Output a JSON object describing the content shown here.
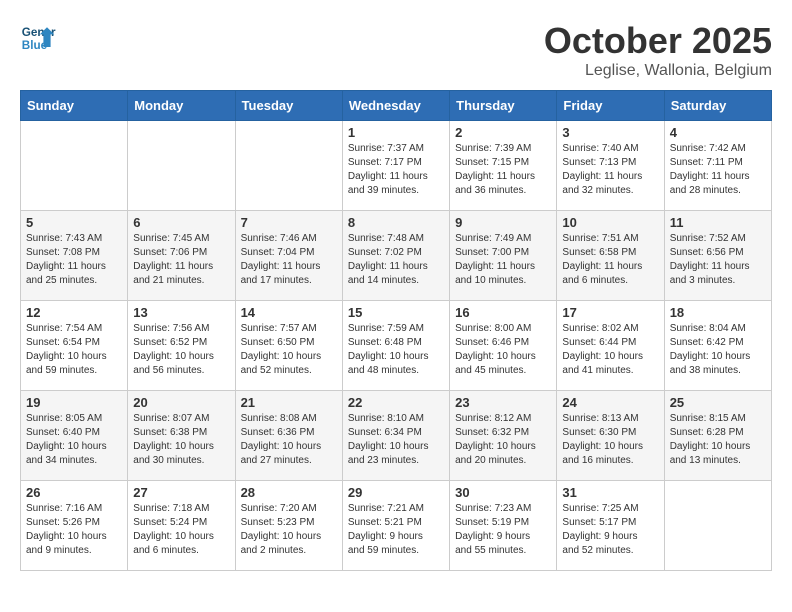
{
  "header": {
    "logo_line1": "General",
    "logo_line2": "Blue",
    "title": "October 2025",
    "subtitle": "Leglise, Wallonia, Belgium"
  },
  "days_of_week": [
    "Sunday",
    "Monday",
    "Tuesday",
    "Wednesday",
    "Thursday",
    "Friday",
    "Saturday"
  ],
  "weeks": [
    [
      {
        "num": "",
        "info": ""
      },
      {
        "num": "",
        "info": ""
      },
      {
        "num": "",
        "info": ""
      },
      {
        "num": "1",
        "info": "Sunrise: 7:37 AM\nSunset: 7:17 PM\nDaylight: 11 hours\nand 39 minutes."
      },
      {
        "num": "2",
        "info": "Sunrise: 7:39 AM\nSunset: 7:15 PM\nDaylight: 11 hours\nand 36 minutes."
      },
      {
        "num": "3",
        "info": "Sunrise: 7:40 AM\nSunset: 7:13 PM\nDaylight: 11 hours\nand 32 minutes."
      },
      {
        "num": "4",
        "info": "Sunrise: 7:42 AM\nSunset: 7:11 PM\nDaylight: 11 hours\nand 28 minutes."
      }
    ],
    [
      {
        "num": "5",
        "info": "Sunrise: 7:43 AM\nSunset: 7:08 PM\nDaylight: 11 hours\nand 25 minutes."
      },
      {
        "num": "6",
        "info": "Sunrise: 7:45 AM\nSunset: 7:06 PM\nDaylight: 11 hours\nand 21 minutes."
      },
      {
        "num": "7",
        "info": "Sunrise: 7:46 AM\nSunset: 7:04 PM\nDaylight: 11 hours\nand 17 minutes."
      },
      {
        "num": "8",
        "info": "Sunrise: 7:48 AM\nSunset: 7:02 PM\nDaylight: 11 hours\nand 14 minutes."
      },
      {
        "num": "9",
        "info": "Sunrise: 7:49 AM\nSunset: 7:00 PM\nDaylight: 11 hours\nand 10 minutes."
      },
      {
        "num": "10",
        "info": "Sunrise: 7:51 AM\nSunset: 6:58 PM\nDaylight: 11 hours\nand 6 minutes."
      },
      {
        "num": "11",
        "info": "Sunrise: 7:52 AM\nSunset: 6:56 PM\nDaylight: 11 hours\nand 3 minutes."
      }
    ],
    [
      {
        "num": "12",
        "info": "Sunrise: 7:54 AM\nSunset: 6:54 PM\nDaylight: 10 hours\nand 59 minutes."
      },
      {
        "num": "13",
        "info": "Sunrise: 7:56 AM\nSunset: 6:52 PM\nDaylight: 10 hours\nand 56 minutes."
      },
      {
        "num": "14",
        "info": "Sunrise: 7:57 AM\nSunset: 6:50 PM\nDaylight: 10 hours\nand 52 minutes."
      },
      {
        "num": "15",
        "info": "Sunrise: 7:59 AM\nSunset: 6:48 PM\nDaylight: 10 hours\nand 48 minutes."
      },
      {
        "num": "16",
        "info": "Sunrise: 8:00 AM\nSunset: 6:46 PM\nDaylight: 10 hours\nand 45 minutes."
      },
      {
        "num": "17",
        "info": "Sunrise: 8:02 AM\nSunset: 6:44 PM\nDaylight: 10 hours\nand 41 minutes."
      },
      {
        "num": "18",
        "info": "Sunrise: 8:04 AM\nSunset: 6:42 PM\nDaylight: 10 hours\nand 38 minutes."
      }
    ],
    [
      {
        "num": "19",
        "info": "Sunrise: 8:05 AM\nSunset: 6:40 PM\nDaylight: 10 hours\nand 34 minutes."
      },
      {
        "num": "20",
        "info": "Sunrise: 8:07 AM\nSunset: 6:38 PM\nDaylight: 10 hours\nand 30 minutes."
      },
      {
        "num": "21",
        "info": "Sunrise: 8:08 AM\nSunset: 6:36 PM\nDaylight: 10 hours\nand 27 minutes."
      },
      {
        "num": "22",
        "info": "Sunrise: 8:10 AM\nSunset: 6:34 PM\nDaylight: 10 hours\nand 23 minutes."
      },
      {
        "num": "23",
        "info": "Sunrise: 8:12 AM\nSunset: 6:32 PM\nDaylight: 10 hours\nand 20 minutes."
      },
      {
        "num": "24",
        "info": "Sunrise: 8:13 AM\nSunset: 6:30 PM\nDaylight: 10 hours\nand 16 minutes."
      },
      {
        "num": "25",
        "info": "Sunrise: 8:15 AM\nSunset: 6:28 PM\nDaylight: 10 hours\nand 13 minutes."
      }
    ],
    [
      {
        "num": "26",
        "info": "Sunrise: 7:16 AM\nSunset: 5:26 PM\nDaylight: 10 hours\nand 9 minutes."
      },
      {
        "num": "27",
        "info": "Sunrise: 7:18 AM\nSunset: 5:24 PM\nDaylight: 10 hours\nand 6 minutes."
      },
      {
        "num": "28",
        "info": "Sunrise: 7:20 AM\nSunset: 5:23 PM\nDaylight: 10 hours\nand 2 minutes."
      },
      {
        "num": "29",
        "info": "Sunrise: 7:21 AM\nSunset: 5:21 PM\nDaylight: 9 hours\nand 59 minutes."
      },
      {
        "num": "30",
        "info": "Sunrise: 7:23 AM\nSunset: 5:19 PM\nDaylight: 9 hours\nand 55 minutes."
      },
      {
        "num": "31",
        "info": "Sunrise: 7:25 AM\nSunset: 5:17 PM\nDaylight: 9 hours\nand 52 minutes."
      },
      {
        "num": "",
        "info": ""
      }
    ]
  ]
}
